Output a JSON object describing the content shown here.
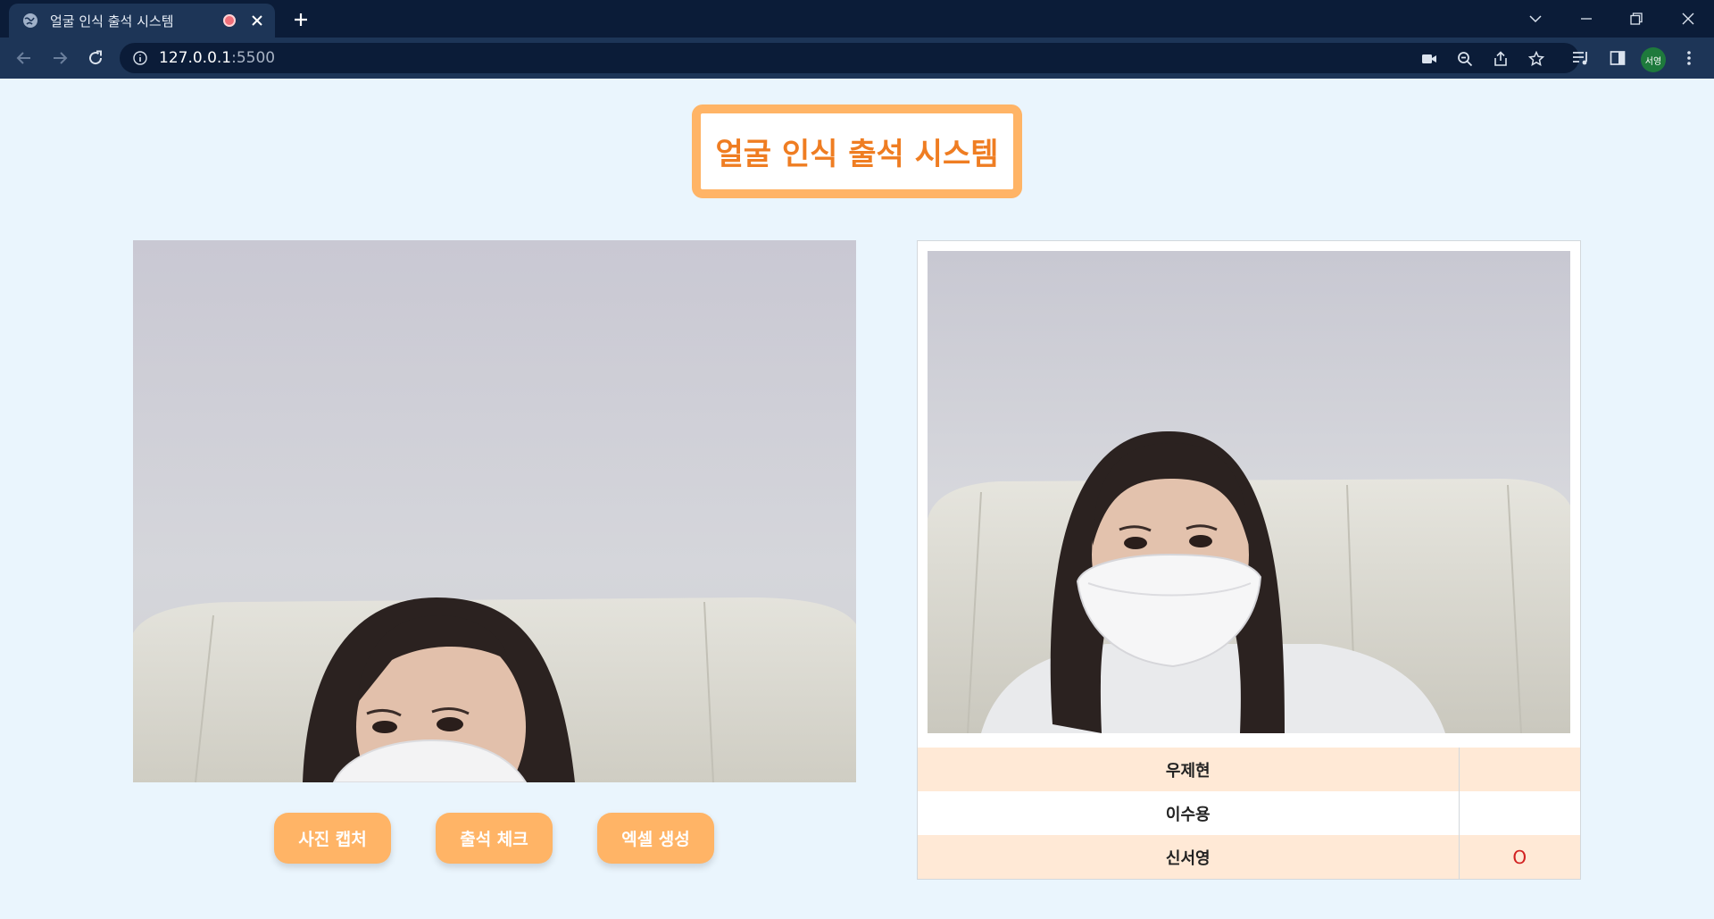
{
  "browser": {
    "tab_title": "얼굴 인식 출석 시스템",
    "url_host": "127.0.0.1",
    "url_port": ":5500",
    "profile_label": "서영"
  },
  "page": {
    "title": "얼굴 인식 출석 시스템",
    "buttons": {
      "capture": "사진 캡처",
      "check": "출석 체크",
      "excel": "엑셀 생성"
    },
    "attendance": [
      {
        "name": "우제현",
        "status": ""
      },
      {
        "name": "이수용",
        "status": ""
      },
      {
        "name": "신서영",
        "status": "O"
      }
    ]
  },
  "colors": {
    "accent": "#ffb466",
    "title_text": "#ef7d22",
    "page_bg": "#eaf5fd",
    "row_highlight": "#ffe9d6",
    "mark": "#d22020"
  }
}
